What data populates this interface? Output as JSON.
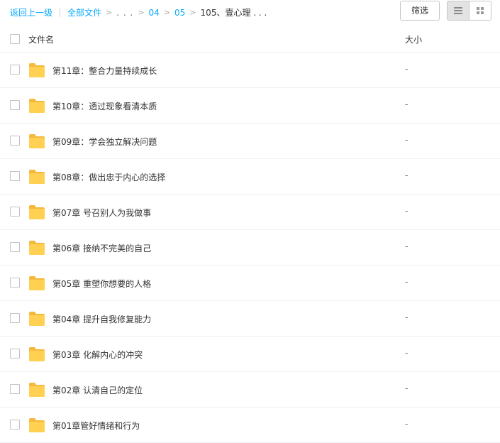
{
  "breadcrumb": {
    "back": "返回上一级",
    "all_files": "全部文件",
    "ellipsis": ". . .",
    "crumb1": "04",
    "crumb2": "05",
    "current": "105、壹心理 . . ."
  },
  "toolbar": {
    "filter_label": "筛选",
    "view_modes": [
      "list-view-icon",
      "grid-view-icon"
    ],
    "active_view": "list"
  },
  "table": {
    "col_name": "文件名",
    "col_size": "大小",
    "rows": [
      {
        "name": "第11章：整合力量持续成长",
        "size": "-"
      },
      {
        "name": "第10章：透过现象看清本质",
        "size": "-"
      },
      {
        "name": "第09章：学会独立解决问题",
        "size": "-"
      },
      {
        "name": "第08章：做出忠于内心的选择",
        "size": "-"
      },
      {
        "name": "第07章 号召别人为我做事",
        "size": "-"
      },
      {
        "name": "第06章 接纳不完美的自己",
        "size": "-"
      },
      {
        "name": "第05章 重塑你想要的人格",
        "size": "-"
      },
      {
        "name": "第04章 提升自我修复能力",
        "size": "-"
      },
      {
        "name": "第03章 化解内心的冲突",
        "size": "-"
      },
      {
        "name": "第02章 认清自己的定位",
        "size": "-"
      },
      {
        "name": "第01章管好情绪和行为",
        "size": "-"
      }
    ]
  },
  "colors": {
    "link": "#09aaff",
    "folder_body": "#ffd052",
    "folder_tab": "#f5b93d"
  }
}
